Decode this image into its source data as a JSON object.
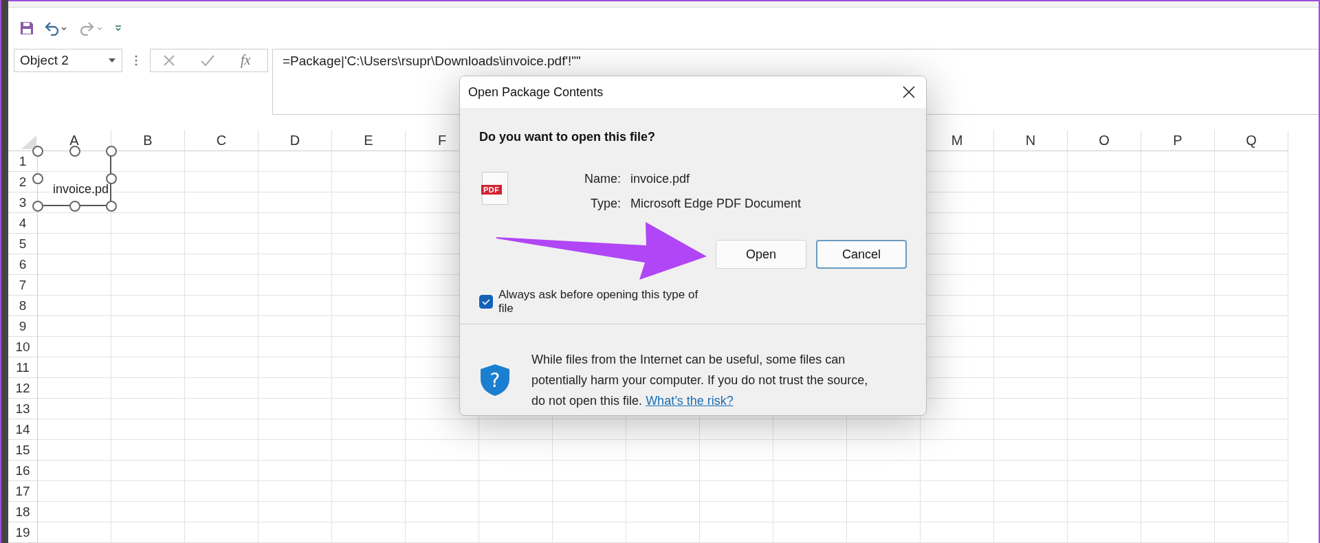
{
  "name_box": {
    "value": "Object 2"
  },
  "formula_bar": {
    "function_label": "fx",
    "value": "=Package|'C:\\Users\\rsupr\\Downloads\\invoice.pdf'!\"\""
  },
  "sheet": {
    "columns": [
      "A",
      "B",
      "C",
      "D",
      "E",
      "F",
      "M",
      "N",
      "O",
      "P",
      "Q"
    ],
    "rows": [
      "1",
      "2",
      "3",
      "4",
      "5",
      "6",
      "7",
      "8",
      "9",
      "10",
      "11",
      "12",
      "13",
      "14",
      "15",
      "16",
      "17",
      "18",
      "19"
    ],
    "embedded_object": {
      "label": "invoice.pd",
      "selected": true
    }
  },
  "dialog": {
    "title": "Open Package Contents",
    "heading": "Do you want to open this file?",
    "file": {
      "icon_label": "PDF",
      "name_label": "Name:",
      "name": "invoice.pdf",
      "type_label": "Type:",
      "type": "Microsoft Edge PDF Document"
    },
    "buttons": [
      {
        "label": "Open",
        "focused": false
      },
      {
        "label": "Cancel",
        "focused": true
      }
    ],
    "checkbox": {
      "label": "Always ask before opening this type of file",
      "checked": true
    },
    "warning": {
      "icon_glyph": "?",
      "text": "While files from the Internet can be useful, some files can potentially harm your computer. If you do not trust the source, do not open this file.",
      "link": "What’s the risk?"
    }
  }
}
